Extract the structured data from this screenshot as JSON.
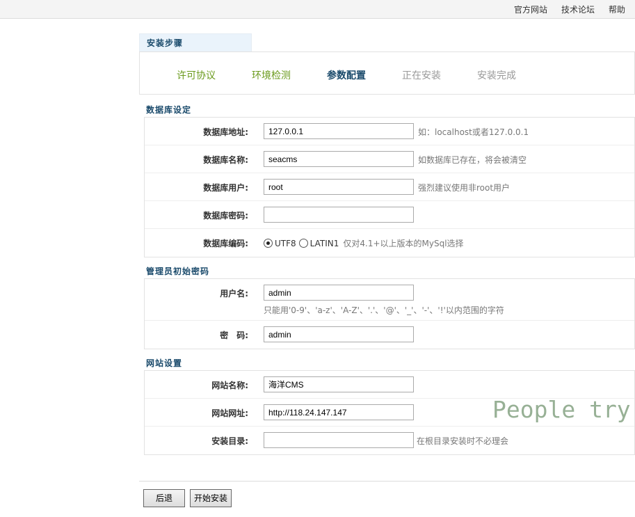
{
  "top_links": [
    "官方网站",
    "技术论坛",
    "帮助"
  ],
  "steps_title": "安装步骤",
  "steps": [
    "许可协议",
    "环境检测",
    "参数配置",
    "正在安装",
    "安装完成"
  ],
  "db_section": {
    "title": "数据库设定",
    "host_label": "数据库地址:",
    "host_value": "127.0.0.1",
    "host_hint": "如：localhost或者127.0.0.1",
    "name_label": "数据库名称:",
    "name_value": "seacms",
    "name_hint": "如数据库已存在，将会被清空",
    "user_label": "数据库用户:",
    "user_value": "root",
    "user_hint": "强烈建议使用非root用户",
    "pass_label": "数据库密码:",
    "pass_value": "",
    "enc_label": "数据库编码:",
    "enc_options": [
      "UTF8",
      "LATIN1"
    ],
    "enc_hint": "仅对4.1+以上版本的MySql选择"
  },
  "admin_section": {
    "title": "管理员初始密码",
    "user_label": "用户名:",
    "user_value": "admin",
    "user_hint": "只能用'0-9'、'a-z'、'A-Z'、'.'、'@'、'_'、'-'、'!'以内范围的字符",
    "pass_label": "密　码:",
    "pass_value": "admin"
  },
  "site_section": {
    "title": "网站设置",
    "name_label": "网站名称:",
    "name_value": "海洋CMS",
    "url_label": "网站网址:",
    "url_value": "http://118.24.147.147",
    "dir_label": "安装目录:",
    "dir_value": "",
    "dir_hint": "在根目录安装时不必理会"
  },
  "buttons": {
    "back": "后退",
    "install": "开始安装"
  },
  "watermark": "People try t"
}
